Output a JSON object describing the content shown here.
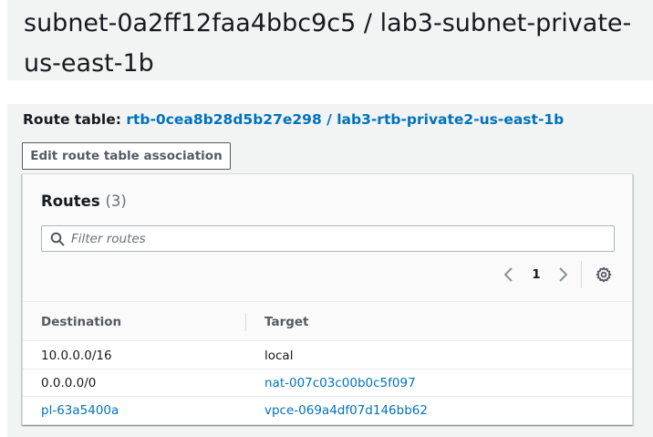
{
  "header": {
    "title_line1": "subnet-0a2ff12faa4bbc9c5 / lab3-subnet-private-",
    "title_line2": "us-east-1b"
  },
  "route_table": {
    "label": "Route table:",
    "id": "rtb-0cea8b28d5b27e298",
    "separator": "/",
    "name": "lab3-rtb-private2-us-east-1b",
    "link_color": "#0073bb"
  },
  "actions": {
    "edit_association_label": "Edit route table association"
  },
  "routes": {
    "title": "Routes",
    "count": "(3)",
    "filter_placeholder": "Filter routes",
    "filter_value": "",
    "filter_icon": "search-icon",
    "pagination": {
      "current_page": "1",
      "prev_icon": "chevron-left-icon",
      "next_icon": "chevron-right-icon",
      "settings_icon": "gear-icon"
    },
    "columns": [
      "Destination",
      "Target"
    ],
    "rows": [
      {
        "destination": "10.0.0.0/16",
        "destination_is_link": false,
        "target": "local",
        "target_is_link": false
      },
      {
        "destination": "0.0.0.0/0",
        "destination_is_link": false,
        "target": "nat-007c03c00b0c5f097",
        "target_is_link": true
      },
      {
        "destination": "pl-63a5400a",
        "destination_is_link": true,
        "target": "vpce-069a4df07d146bb62",
        "target_is_link": true
      }
    ]
  },
  "colors": {
    "background_panel": "#f2f3f3",
    "text_primary": "#16191f",
    "text_secondary": "#545b64",
    "link": "#0073bb",
    "border": "#aab7b8"
  }
}
